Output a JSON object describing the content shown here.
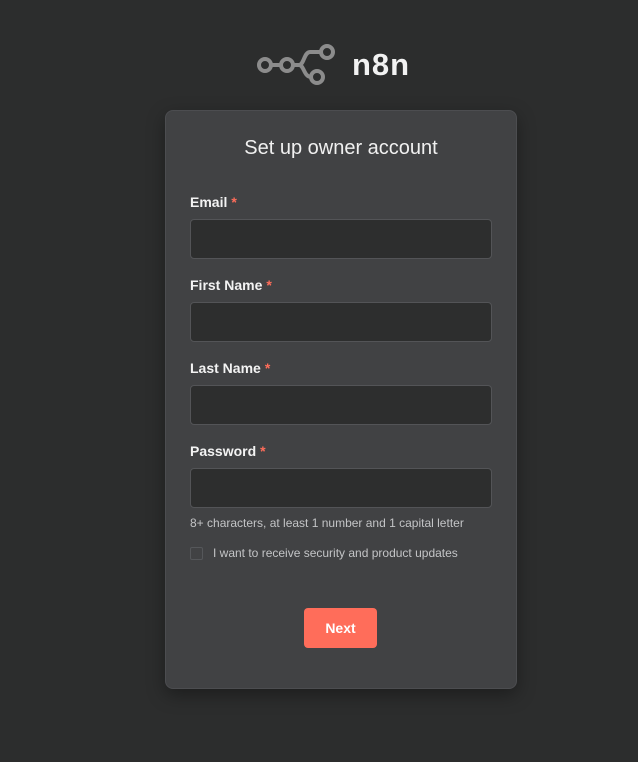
{
  "brand": {
    "name": "n8n",
    "logo_icon": "n8n-nodes-logo-icon"
  },
  "form": {
    "title": "Set up owner account",
    "required_marker": "*",
    "fields": [
      {
        "label": "Email",
        "value": "",
        "placeholder": ""
      },
      {
        "label": "First Name",
        "value": "",
        "placeholder": ""
      },
      {
        "label": "Last Name",
        "value": "",
        "placeholder": ""
      },
      {
        "label": "Password",
        "value": "",
        "placeholder": ""
      }
    ],
    "password_hint": "8+ characters, at least 1 number and 1 capital letter",
    "updates_checkbox": {
      "label": "I want to receive security and product updates",
      "checked": false
    },
    "next_label": "Next"
  },
  "colors": {
    "background": "#2c2d2d",
    "card": "#414244",
    "input": "#2d2e2e",
    "accent": "#ff6d5a",
    "logo": "#8c8c8c"
  }
}
